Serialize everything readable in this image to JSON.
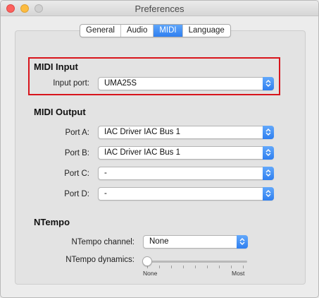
{
  "window": {
    "title": "Preferences",
    "buttons": [
      "close",
      "minimize",
      "zoom"
    ]
  },
  "tabs": [
    {
      "label": "General",
      "active": false
    },
    {
      "label": "Audio",
      "active": false
    },
    {
      "label": "MIDI",
      "active": true
    },
    {
      "label": "Language",
      "active": false
    }
  ],
  "midi_input": {
    "title": "MIDI Input",
    "input_port_label": "Input port:",
    "input_port_value": "UMA25S"
  },
  "midi_output": {
    "title": "MIDI Output",
    "ports": [
      {
        "label": "Port A:",
        "value": "IAC Driver IAC Bus 1"
      },
      {
        "label": "Port B:",
        "value": "IAC Driver IAC Bus 1"
      },
      {
        "label": "Port C:",
        "value": "-"
      },
      {
        "label": "Port D:",
        "value": "-"
      }
    ]
  },
  "ntempo": {
    "title": "NTempo",
    "channel_label": "NTempo channel:",
    "channel_value": "None",
    "dynamics_label": "NTempo dynamics:",
    "dynamics_min_label": "None",
    "dynamics_max_label": "Most",
    "dynamics_level": 0
  },
  "colors": {
    "accent": "#2f7ff0",
    "highlight_border": "#d8151c"
  }
}
